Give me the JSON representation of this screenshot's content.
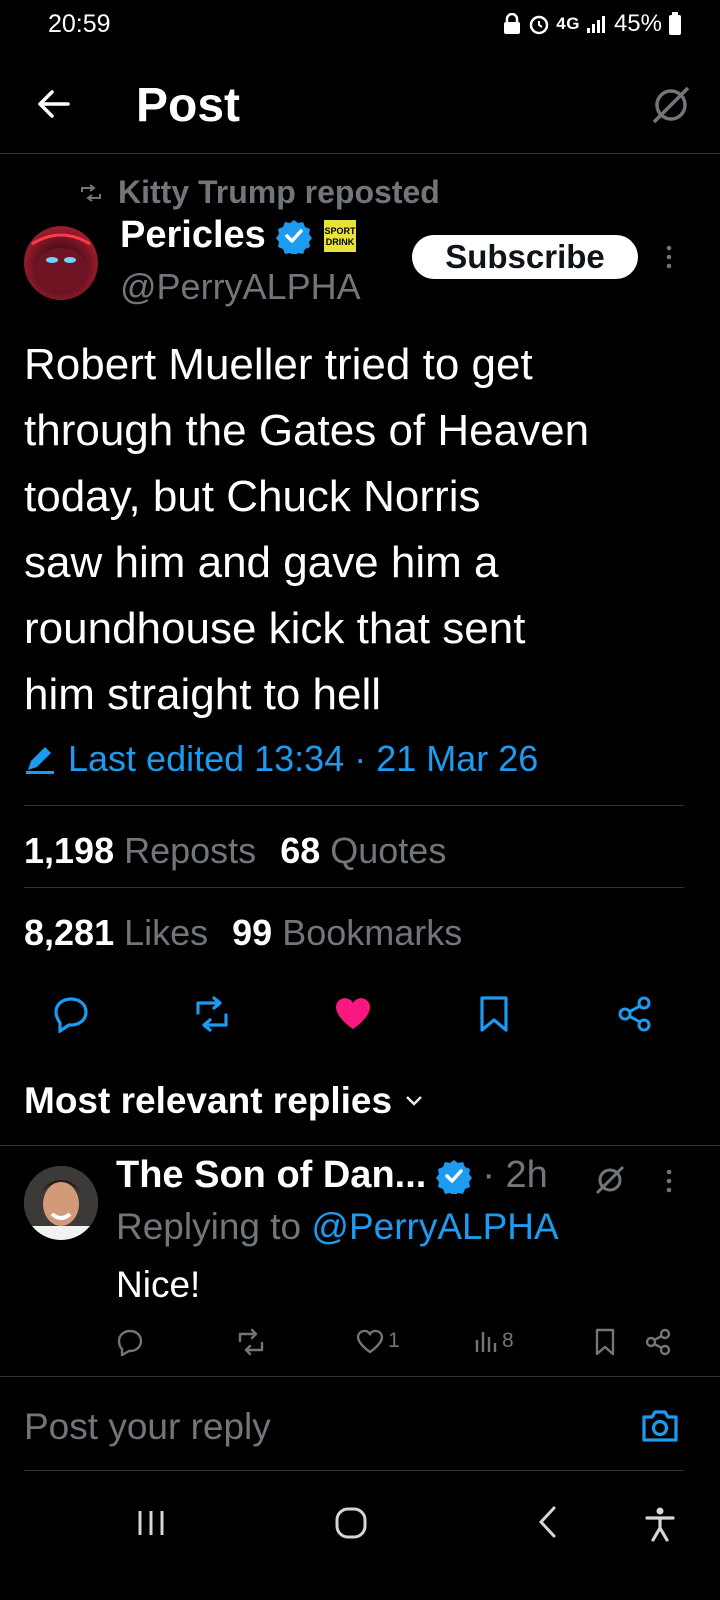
{
  "status_bar": {
    "time": "20:59",
    "network": "4G",
    "battery": "45%"
  },
  "header": {
    "title": "Post",
    "back_icon": "arrow-left-icon",
    "audience_icon": "no-audience-icon"
  },
  "repost": {
    "text": "Kitty Trump reposted"
  },
  "author": {
    "name": "Pericles",
    "handle": "@PerryALPHA",
    "badge_text": "SPORT DRINK",
    "subscribe_label": "Subscribe"
  },
  "tweet": {
    "lines": [
      "Robert Mueller tried to get",
      "through the Gates of Heaven",
      "today, but Chuck Norris",
      "saw him and gave him a",
      "roundhouse kick that sent",
      "him straight to hell"
    ],
    "edited_label": "Last edited 13:34 · 21 Mar 26"
  },
  "stats": {
    "reposts_count": "1,198",
    "reposts_label": "Reposts",
    "quotes_count": "68",
    "quotes_label": "Quotes",
    "likes_count": "8,281",
    "likes_label": "Likes",
    "bookmarks_count": "99",
    "bookmarks_label": "Bookmarks"
  },
  "replies": {
    "sort_label": "Most relevant replies",
    "items": [
      {
        "name": "The Son of Dan...",
        "time": "· 2h",
        "replying_prefix": "Replying to",
        "replying_handle": "@PerryALPHA",
        "text": "Nice!",
        "likes": "1",
        "views": "8"
      }
    ]
  },
  "composer": {
    "placeholder": "Post your reply"
  },
  "colors": {
    "accent": "#1d9bf0",
    "like": "#f91880",
    "muted": "#71767b",
    "background": "#000000"
  }
}
